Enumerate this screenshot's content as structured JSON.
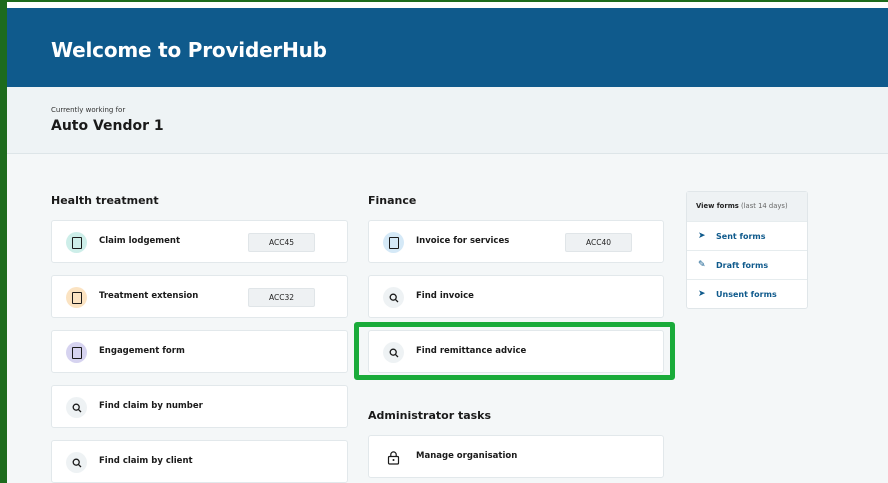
{
  "header": {
    "title": "Welcome to ProviderHub"
  },
  "context": {
    "label": "Currently working for",
    "value": "Auto Vendor 1"
  },
  "health": {
    "title": "Health treatment",
    "items": [
      {
        "label": "Claim lodgement",
        "tag": "ACC45",
        "icon": "document-icon",
        "color": "#cdeee9"
      },
      {
        "label": "Treatment extension",
        "tag": "ACC32",
        "icon": "document-icon",
        "color": "#fbe3c2"
      },
      {
        "label": "Engagement form",
        "icon": "document-icon",
        "color": "#d6d3f0"
      },
      {
        "label": "Find claim by number",
        "icon": "search-icon"
      },
      {
        "label": "Find claim by client",
        "icon": "search-icon"
      }
    ]
  },
  "finance": {
    "title": "Finance",
    "items": [
      {
        "label": "Invoice for services",
        "tag": "ACC40",
        "icon": "document-icon",
        "color": "#d5e9f7"
      },
      {
        "label": "Find invoice",
        "icon": "search-icon"
      },
      {
        "label": "Find remittance advice",
        "icon": "search-icon"
      }
    ]
  },
  "admin": {
    "title": "Administrator tasks",
    "items": [
      {
        "label": "Manage organisation",
        "icon": "lock-icon"
      }
    ]
  },
  "forms": {
    "head_bold": "View forms",
    "head_note": "(last 14 days)",
    "items": [
      {
        "label": "Sent forms",
        "icon": "send-icon"
      },
      {
        "label": "Draft forms",
        "icon": "edit-icon"
      },
      {
        "label": "Unsent forms",
        "icon": "send-icon"
      }
    ]
  },
  "colors": {
    "brand": "#0f5a8c",
    "highlight": "#1aab3a"
  }
}
